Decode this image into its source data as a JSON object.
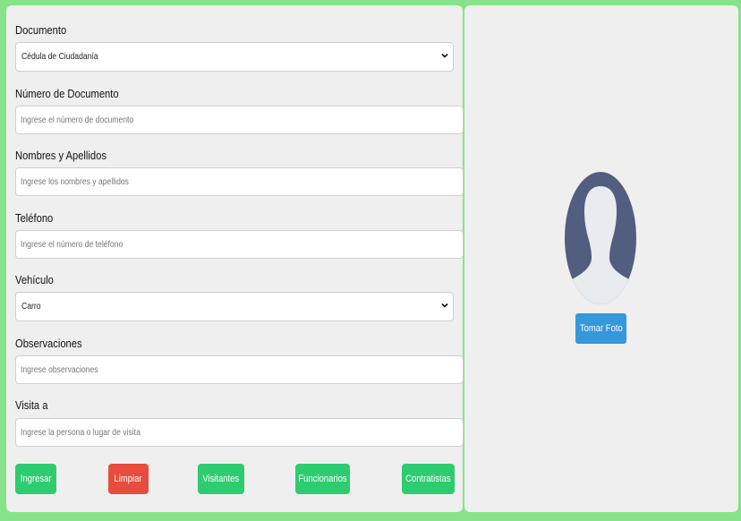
{
  "form": {
    "documento": {
      "label": "Documento",
      "selected": "Cédula de Ciudadanía"
    },
    "numero_documento": {
      "label": "Número de Documento",
      "placeholder": "Ingrese el número de documento"
    },
    "nombres": {
      "label": "Nombres y Apellidos",
      "placeholder": "Ingrese los nombres y apellidos"
    },
    "telefono": {
      "label": "Teléfono",
      "placeholder": "Ingrese el número de teléfono"
    },
    "vehiculo": {
      "label": "Vehículo",
      "selected": "Carro"
    },
    "observaciones": {
      "label": "Observaciones",
      "placeholder": "Ingrese observaciones"
    },
    "visita": {
      "label": "Visita a",
      "placeholder": "Ingrese la persona o lugar de visita"
    }
  },
  "buttons": {
    "ingresar": "Ingresar",
    "limpiar": "Limpiar",
    "visitantes": "Visitantes",
    "funcionarios": "Funcionarios",
    "contratistas": "Contratistas"
  },
  "photo": {
    "button_label": "Tomar Foto"
  },
  "colors": {
    "background": "#86e38a",
    "panel": "#efefef",
    "green_button": "#2ecc71",
    "red_button": "#e74c3c",
    "blue_button": "#3498db",
    "avatar": "#525e7f"
  },
  "icons": {
    "select_arrow": "chevron-down-icon",
    "avatar": "user-silhouette-icon"
  }
}
